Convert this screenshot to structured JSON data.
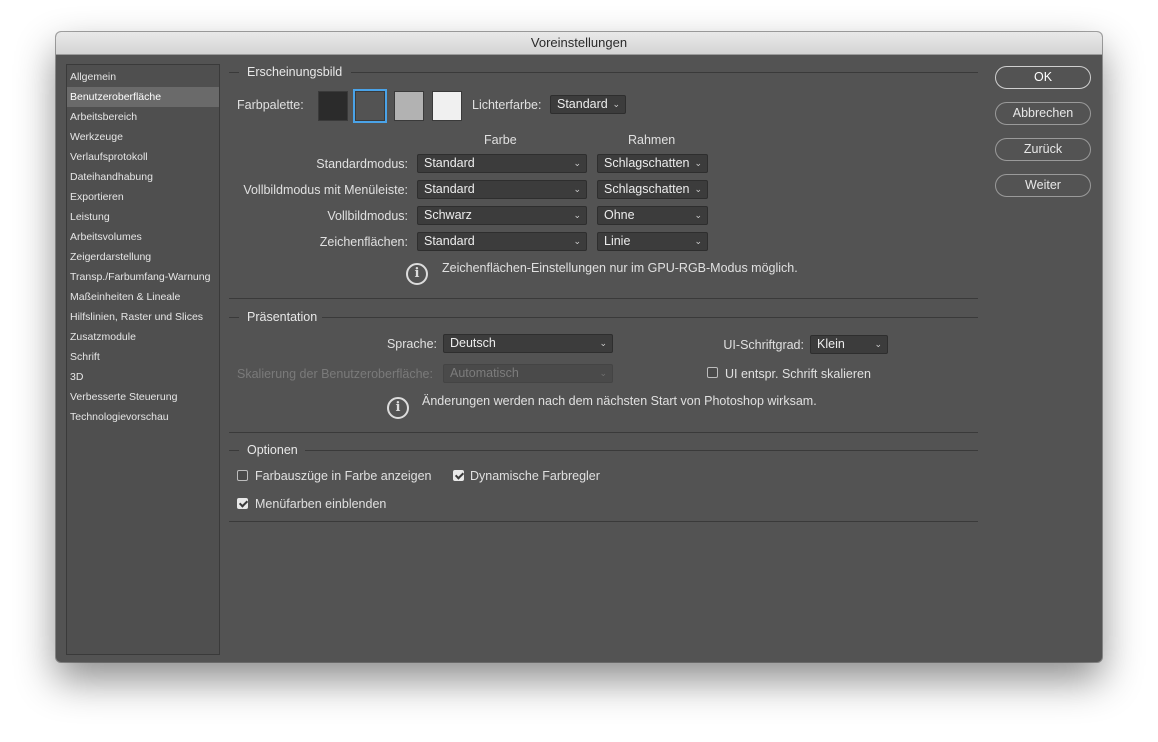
{
  "window": {
    "title": "Voreinstellungen"
  },
  "sidebar": {
    "items": [
      {
        "label": "Allgemein"
      },
      {
        "label": "Benutzeroberfläche",
        "active": true
      },
      {
        "label": "Arbeitsbereich"
      },
      {
        "label": "Werkzeuge"
      },
      {
        "label": "Verlaufsprotokoll"
      },
      {
        "label": "Dateihandhabung"
      },
      {
        "label": "Exportieren"
      },
      {
        "label": "Leistung"
      },
      {
        "label": "Arbeitsvolumes"
      },
      {
        "label": "Zeigerdarstellung"
      },
      {
        "label": "Transp./Farbumfang-Warnung"
      },
      {
        "label": "Maßeinheiten & Lineale"
      },
      {
        "label": "Hilfslinien, Raster und Slices"
      },
      {
        "label": "Zusatzmodule"
      },
      {
        "label": "Schrift"
      },
      {
        "label": "3D"
      },
      {
        "label": "Verbesserte Steuerung"
      },
      {
        "label": "Technologievorschau"
      }
    ]
  },
  "appearance": {
    "group_title": "Erscheinungsbild",
    "palette_label": "Farbpalette:",
    "swatches": [
      "#2b2b2b",
      "#535353",
      "#b2b2b2",
      "#f0f0f0"
    ],
    "selected_swatch": 1,
    "highlight_label": "Lichterfarbe:",
    "highlight_value": "Standard",
    "col_color": "Farbe",
    "col_border": "Rahmen",
    "rows": [
      {
        "label": "Standardmodus:",
        "color": "Standard",
        "border": "Schlagschatten"
      },
      {
        "label": "Vollbildmodus mit Menüleiste:",
        "color": "Standard",
        "border": "Schlagschatten"
      },
      {
        "label": "Vollbildmodus:",
        "color": "Schwarz",
        "border": "Ohne"
      },
      {
        "label": "Zeichenflächen:",
        "color": "Standard",
        "border": "Linie"
      }
    ],
    "info": "Zeichenflächen-Einstellungen nur im GPU-RGB-Modus möglich."
  },
  "presentation": {
    "group_title": "Präsentation",
    "language_label": "Sprache:",
    "language_value": "Deutsch",
    "ui_font_label": "UI-Schriftgrad:",
    "ui_font_value": "Klein",
    "scale_label": "Skalierung der Benutzeroberfläche:",
    "scale_value": "Automatisch",
    "scale_font_label": "UI entspr. Schrift skalieren",
    "scale_font_checked": false,
    "info": "Änderungen werden nach dem nächsten Start von Photoshop wirksam."
  },
  "options": {
    "group_title": "Optionen",
    "channels_color_label": "Farbauszüge in Farbe anzeigen",
    "channels_color_checked": false,
    "dynamic_sliders_label": "Dynamische Farbregler",
    "dynamic_sliders_checked": true,
    "menu_colors_label": "Menüfarben einblenden",
    "menu_colors_checked": true
  },
  "buttons": {
    "ok": "OK",
    "cancel": "Abbrechen",
    "back": "Zurück",
    "next": "Weiter"
  },
  "icons": {
    "dropdown": "chevron-down-icon",
    "info": "info-icon",
    "check": "check-icon"
  },
  "colors": {
    "panel_bg": "#535353",
    "selection_accent": "#4aa3e8"
  }
}
